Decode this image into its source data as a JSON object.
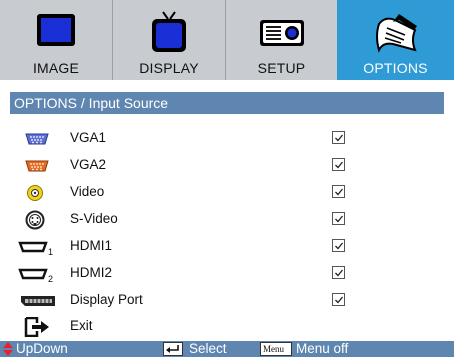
{
  "tabs": [
    {
      "label": "IMAGE",
      "icon": "monitor-icon",
      "active": false
    },
    {
      "label": "DISPLAY",
      "icon": "tv-icon",
      "active": false
    },
    {
      "label": "SETUP",
      "icon": "projector-icon",
      "active": false
    },
    {
      "label": "OPTIONS",
      "icon": "notepad-icon",
      "active": true
    }
  ],
  "title": "OPTIONS / Input Source",
  "sources": [
    {
      "label": "VGA1",
      "icon": "vga-connector-blue-icon",
      "checked": true
    },
    {
      "label": "VGA2",
      "icon": "vga-connector-orange-icon",
      "checked": true
    },
    {
      "label": "Video",
      "icon": "rca-video-icon",
      "checked": true
    },
    {
      "label": "S-Video",
      "icon": "s-video-connector-icon",
      "checked": true
    },
    {
      "label": "HDMI1",
      "icon": "hdmi1-connector-icon",
      "checked": true
    },
    {
      "label": "HDMI2",
      "icon": "hdmi2-connector-icon",
      "checked": true
    },
    {
      "label": "Display Port",
      "icon": "displayport-connector-icon",
      "checked": true
    }
  ],
  "exit": {
    "label": "Exit",
    "icon": "exit-arrow-icon"
  },
  "footer": {
    "updown": "UpDown",
    "select": "Select",
    "menu_key": "Menu",
    "menu_off": "Menu off"
  },
  "colors": {
    "tab_bar": "#c8ccd0",
    "active_tab": "#2f9bd6",
    "title_bar": "#5f86b0",
    "footer_bar": "#5f86b0"
  }
}
